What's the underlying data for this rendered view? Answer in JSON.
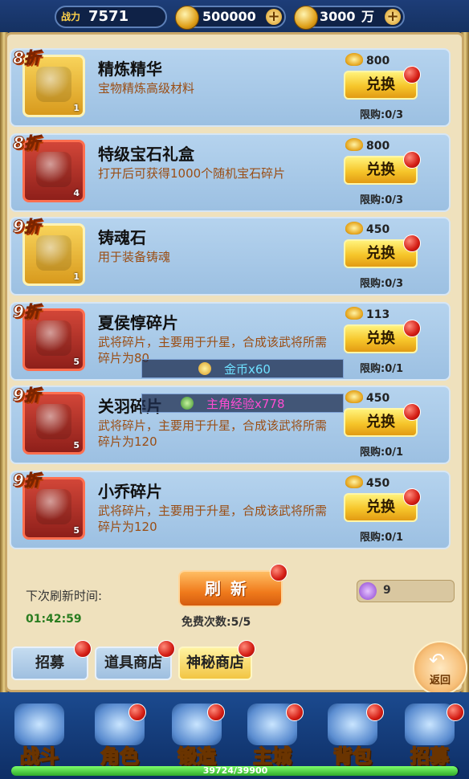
{
  "topbar": {
    "power_label": "战力",
    "power_value": "7571",
    "ingot_value": "500000",
    "coin_value": "3000",
    "coin_unit": "万"
  },
  "items": [
    {
      "discount": "8折",
      "name": "精炼精华",
      "name_color": "#111111",
      "desc": "宝物精炼高级材料",
      "count": "1",
      "price": "800",
      "button": "兑换",
      "limit": "限购:0/3",
      "icon": "ruby-brooch-icon",
      "thumb": "gold"
    },
    {
      "discount": "8折",
      "name": "特级宝石礼盒",
      "name_color": "#111111",
      "desc": "打开后可获得1000个随机宝石碎片",
      "count": "4",
      "price": "800",
      "button": "兑换",
      "limit": "限购:0/3",
      "icon": "treasure-chest-icon",
      "thumb": "red"
    },
    {
      "discount": "9折",
      "name": "铸魂石",
      "name_color": "#111111",
      "desc": "用于装备铸魂",
      "count": "1",
      "price": "450",
      "button": "兑换",
      "limit": "限购:0/3",
      "icon": "soul-stone-icon",
      "thumb": "gold"
    },
    {
      "discount": "9折",
      "name": "夏侯惇碎片",
      "name_color": "#111111",
      "desc": "武将碎片，主要用于升星，合成该武将所需碎片为80",
      "count": "5",
      "price": "113",
      "button": "兑换",
      "limit": "限购:0/1",
      "icon": "hero-portrait-icon",
      "thumb": "red"
    },
    {
      "discount": "9折",
      "name": "关羽碎片",
      "name_color": "#111111",
      "desc": "武将碎片，主要用于升星，合成该武将所需碎片为120",
      "count": "5",
      "price": "450",
      "button": "兑换",
      "limit": "限购:0/1",
      "icon": "hero-portrait-icon",
      "thumb": "red"
    },
    {
      "discount": "9折",
      "name": "小乔碎片",
      "name_color": "#111111",
      "desc": "武将碎片，主要用于升星，合成该武将所需碎片为120",
      "count": "5",
      "price": "450",
      "button": "兑换",
      "limit": "限购:0/1",
      "icon": "hero-portrait-icon",
      "thumb": "red"
    }
  ],
  "toasts": [
    {
      "text": "金币x60",
      "icon": "gold-coin-icon"
    },
    {
      "text": "主角经验x778",
      "icon": "exp-badge-icon"
    }
  ],
  "refresh": {
    "label": "下次刷新时间:",
    "timer": "01:42:59",
    "button": "刷新",
    "free_label": "免费次数:5/5",
    "token_value": "9"
  },
  "tabs": [
    "招募",
    "道具商店",
    "神秘商店"
  ],
  "back_label": "返回",
  "nav": [
    "战斗",
    "角色",
    "锻造",
    "主城",
    "背包",
    "招募"
  ],
  "exp": {
    "text": "39724/39900",
    "progress": 0.9956
  },
  "colors": {
    "accent": "#f6c52a",
    "red_dot": "#d41d14",
    "panel": "#efe1bd"
  }
}
